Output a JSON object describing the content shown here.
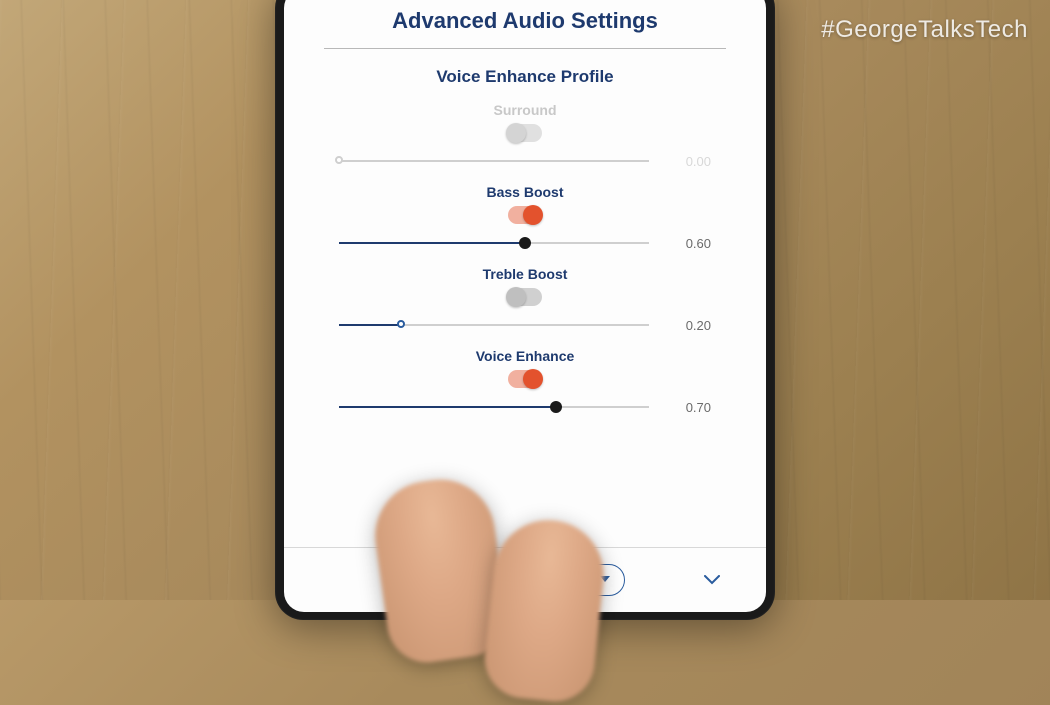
{
  "watermark": "#GeorgeTalksTech",
  "header": {
    "title": "Advanced Audio Settings",
    "subtitle": "Voice Enhance Profile"
  },
  "controls": {
    "surround": {
      "label": "Surround",
      "enabled": false,
      "toggle_on": false,
      "value": 0.0,
      "value_display": "0.00"
    },
    "bass_boost": {
      "label": "Bass Boost",
      "enabled": true,
      "toggle_on": true,
      "value": 0.6,
      "value_display": "0.60"
    },
    "treble_boost": {
      "label": "Treble Boost",
      "enabled": true,
      "toggle_on": false,
      "value": 0.2,
      "value_display": "0.20"
    },
    "voice_enhance": {
      "label": "Voice Enhance",
      "enabled": true,
      "toggle_on": true,
      "value": 0.7,
      "value_display": "0.70"
    }
  },
  "bottom": {
    "dropdown_label": ""
  },
  "colors": {
    "primary": "#1e3a6e",
    "accent": "#e3522d"
  }
}
